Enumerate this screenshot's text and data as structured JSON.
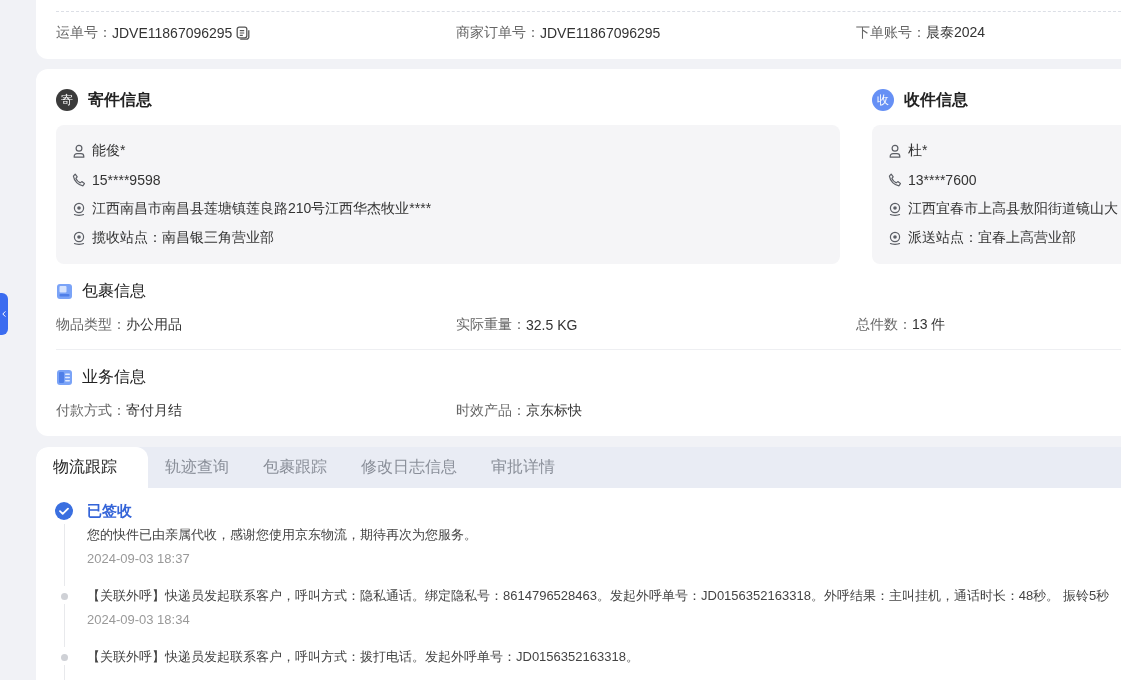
{
  "waybill": {
    "fields": [
      {
        "label": "运单号：",
        "value": "JDVE11867096295",
        "copyable": true
      },
      {
        "label": "商家订单号：",
        "value": "JDVE11867096295",
        "copyable": false
      },
      {
        "label": "下单账号：",
        "value": "晨泰2024",
        "copyable": false
      }
    ]
  },
  "parties": [
    {
      "badge": "寄",
      "color": "#3b3b3b",
      "title": "寄件信息",
      "rows": [
        {
          "kind": "person",
          "text": "能俊*"
        },
        {
          "kind": "phone",
          "text": "15****9598"
        },
        {
          "kind": "address",
          "text": "江西南昌市南昌县莲塘镇莲良路210号江西华杰牧业****"
        },
        {
          "kind": "station",
          "text": "揽收站点：南昌银三角营业部"
        }
      ]
    },
    {
      "badge": "收",
      "color": "#6690f5",
      "title": "收件信息",
      "rows": [
        {
          "kind": "person",
          "text": "杜*"
        },
        {
          "kind": "phone",
          "text": "13****7600"
        },
        {
          "kind": "address",
          "text": "江西宜春市上高县敖阳街道镜山大"
        },
        {
          "kind": "station",
          "text": "派送站点：宜春上高营业部"
        }
      ]
    }
  ],
  "sections": [
    {
      "kind": "package",
      "title": "包裹信息",
      "fields": [
        {
          "label": "物品类型：",
          "value": "办公用品"
        },
        {
          "label": "实际重量：",
          "value": "32.5 KG"
        },
        {
          "label": "总件数：",
          "value": "13 件"
        }
      ]
    },
    {
      "kind": "business",
      "title": "业务信息",
      "fields": [
        {
          "label": "付款方式：",
          "value": "寄付月结"
        },
        {
          "label": "时效产品：",
          "value": "京东标快"
        }
      ]
    }
  ],
  "tabs": [
    {
      "label": "物流跟踪",
      "selected": true
    },
    {
      "label": "轨迹查询",
      "selected": false
    },
    {
      "label": "包裹跟踪",
      "selected": false
    },
    {
      "label": "修改日志信息",
      "selected": false
    },
    {
      "label": "审批详情",
      "selected": false
    }
  ],
  "tracking": [
    {
      "kind": "status",
      "title": "已签收",
      "text": "您的快件已由亲属代收，感谢您使用京东物流，期待再次为您服务。",
      "time": "2024-09-03 18:37"
    },
    {
      "kind": "event",
      "text": "【关联外呼】快递员发起联系客户，呼叫方式：隐私通话。绑定隐私号：8614796528463。发起外呼单号：JD0156352163318。外呼结果：主叫挂机，通话时长：48秒。 振铃5秒",
      "time": "2024-09-03 18:34"
    },
    {
      "kind": "event",
      "text": "【关联外呼】快递员发起联系客户，呼叫方式：拨打电话。发起外呼单号：JD0156352163318。"
    }
  ]
}
